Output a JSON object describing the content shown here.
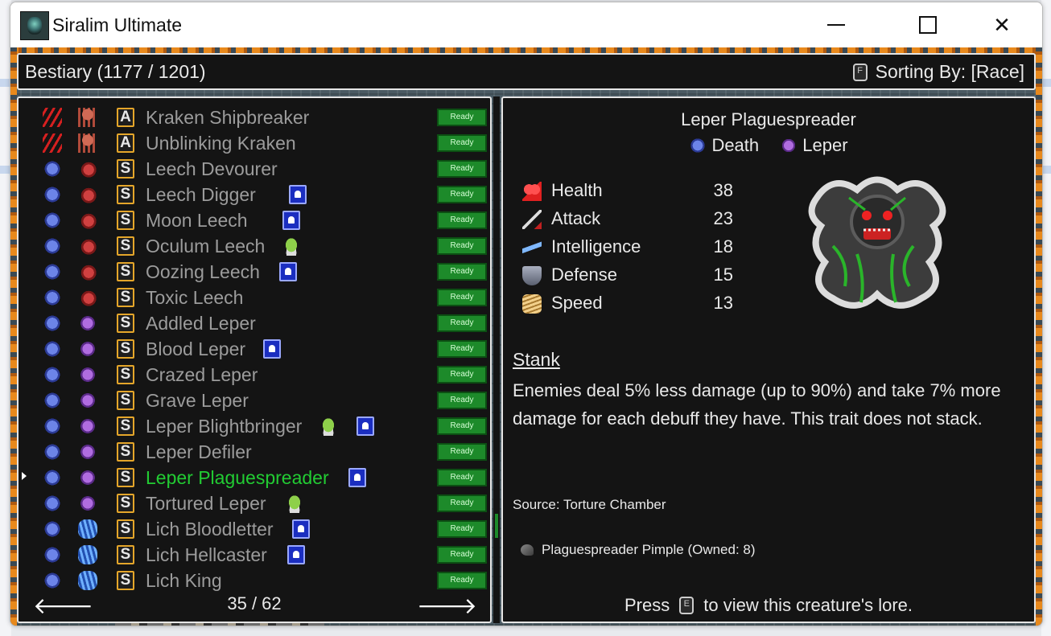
{
  "window": {
    "title": "Siralim Ultimate"
  },
  "header": {
    "title": "Bestiary (1177 / 1201)",
    "sort_key": "F",
    "sort_label": "Sorting By: [Race]"
  },
  "list": {
    "ready_label": "Ready",
    "items": [
      {
        "name": "Kraken Shipbreaker",
        "element": "claw",
        "race": "kraken",
        "type": "A",
        "extras": []
      },
      {
        "name": "Unblinking Kraken",
        "element": "claw",
        "race": "kraken",
        "type": "A",
        "extras": []
      },
      {
        "name": "Leech Devourer",
        "element": "death",
        "race": "leech",
        "type": "S",
        "extras": []
      },
      {
        "name": "Leech Digger",
        "element": "death",
        "race": "leech",
        "type": "S",
        "extras": [
          "card"
        ]
      },
      {
        "name": "Moon Leech",
        "element": "death",
        "race": "leech",
        "type": "S",
        "extras": [
          "card"
        ]
      },
      {
        "name": "Oculum Leech",
        "element": "death",
        "race": "leech",
        "type": "S",
        "extras": [
          "slime"
        ]
      },
      {
        "name": "Oozing Leech",
        "element": "death",
        "race": "leech",
        "type": "S",
        "extras": [
          "card"
        ]
      },
      {
        "name": "Toxic Leech",
        "element": "death",
        "race": "leech",
        "type": "S",
        "extras": []
      },
      {
        "name": "Addled Leper",
        "element": "death",
        "race": "leper",
        "type": "S",
        "extras": []
      },
      {
        "name": "Blood Leper",
        "element": "death",
        "race": "leper",
        "type": "S",
        "extras": [
          "card"
        ]
      },
      {
        "name": "Crazed Leper",
        "element": "death",
        "race": "leper",
        "type": "S",
        "extras": []
      },
      {
        "name": "Grave Leper",
        "element": "death",
        "race": "leper",
        "type": "S",
        "extras": []
      },
      {
        "name": "Leper Blightbringer",
        "element": "death",
        "race": "leper",
        "type": "S",
        "extras": [
          "slime",
          "card"
        ]
      },
      {
        "name": "Leper Defiler",
        "element": "death",
        "race": "leper",
        "type": "S",
        "extras": []
      },
      {
        "name": "Leper Plaguespreader",
        "element": "death",
        "race": "leper",
        "type": "S",
        "extras": [
          "card"
        ],
        "selected": true
      },
      {
        "name": "Tortured Leper",
        "element": "death",
        "race": "leper",
        "type": "S",
        "extras": [
          "slime"
        ]
      },
      {
        "name": "Lich Bloodletter",
        "element": "death",
        "race": "lich",
        "type": "S",
        "extras": [
          "card"
        ]
      },
      {
        "name": "Lich Hellcaster",
        "element": "death",
        "race": "lich",
        "type": "S",
        "extras": [
          "card"
        ]
      },
      {
        "name": "Lich King",
        "element": "death",
        "race": "lich",
        "type": "S",
        "extras": []
      }
    ],
    "page": "35 / 62"
  },
  "detail": {
    "name": "Leper Plaguespreader",
    "class": "Death",
    "race": "Leper",
    "stats": [
      {
        "label": "Health",
        "value": "38",
        "icon": "heart-icon"
      },
      {
        "label": "Attack",
        "value": "23",
        "icon": "sword-icon"
      },
      {
        "label": "Intelligence",
        "value": "18",
        "icon": "bolt-icon"
      },
      {
        "label": "Defense",
        "value": "15",
        "icon": "shield-icon"
      },
      {
        "label": "Speed",
        "value": "13",
        "icon": "wing-icon"
      }
    ],
    "trait_name": "Stank",
    "trait_desc": "Enemies deal 5% less damage (up to 90%) and take 7% more damage for each debuff they have. This trait does not stack.",
    "source": "Source: Torture Chamber",
    "item": "Plaguespreader Pimple (Owned: 8)",
    "press_pre": "Press",
    "press_key": "E",
    "press_post": "to view this creature's lore."
  },
  "colors": {
    "selected": "#22cc33",
    "ready_bg": "#1d8a2a",
    "type_border": "#e5a62a"
  }
}
